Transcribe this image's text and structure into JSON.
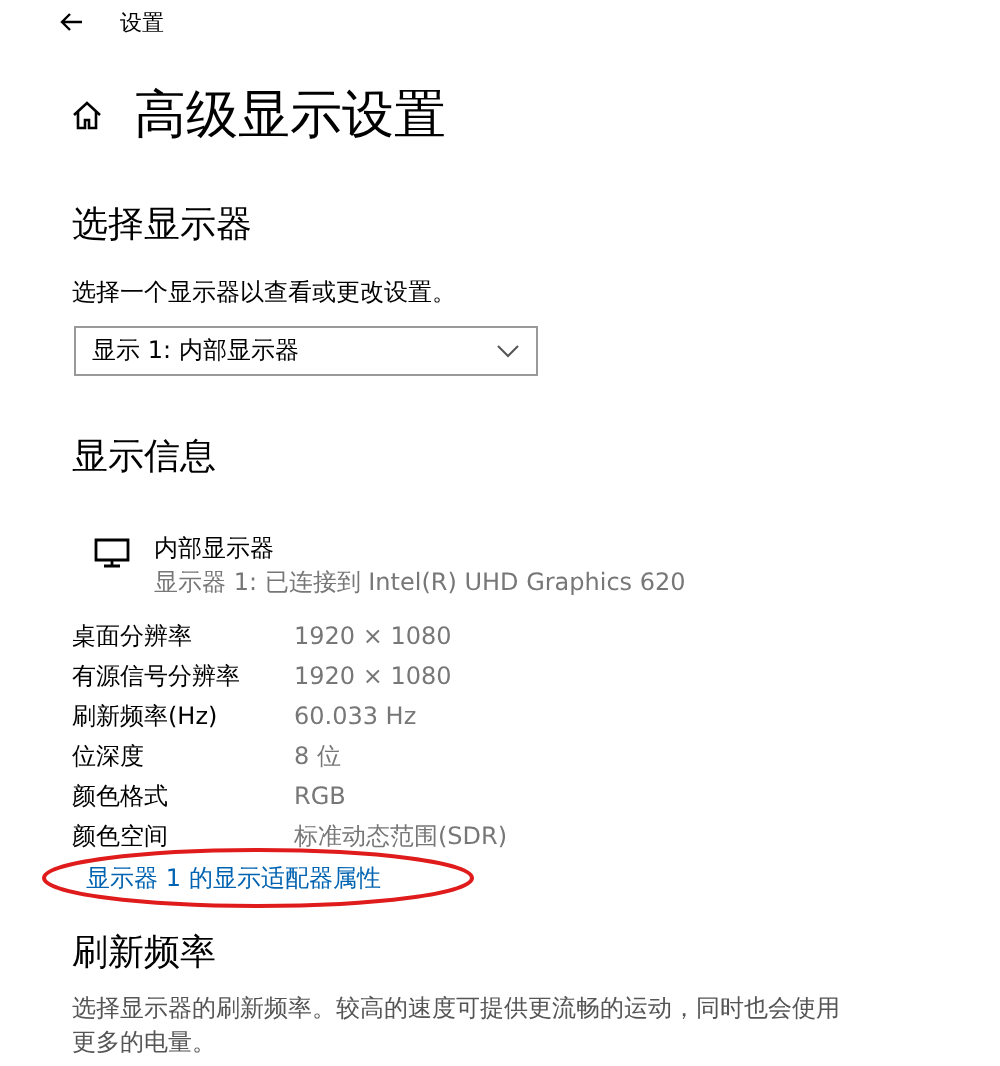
{
  "header": {
    "title": "设置"
  },
  "page_title": "高级显示设置",
  "select_display": {
    "heading": "选择显示器",
    "description": "选择一个显示器以查看或更改设置。",
    "dropdown": {
      "value": "显示 1: 内部显示器"
    }
  },
  "display_info": {
    "heading": "显示信息",
    "monitor": {
      "name": "内部显示器",
      "detail": "显示器 1: 已连接到 Intel(R) UHD Graphics 620"
    },
    "rows": [
      {
        "label": "桌面分辨率",
        "value": "1920 × 1080"
      },
      {
        "label": "有源信号分辨率",
        "value": "1920 × 1080"
      },
      {
        "label": "刷新频率(Hz)",
        "value": "60.033 Hz"
      },
      {
        "label": "位深度",
        "value": "8 位"
      },
      {
        "label": "颜色格式",
        "value": "RGB"
      },
      {
        "label": "颜色空间",
        "value": "标准动态范围(SDR)"
      }
    ],
    "link": {
      "text": "显示器 1 的显示适配器属性",
      "annotation": {
        "kind": "ellipse"
      }
    }
  },
  "refresh_rate": {
    "heading": "刷新频率",
    "description": "选择显示器的刷新频率。较高的速度可提供更流畅的运动，同时也会使用更多的电量。"
  }
}
